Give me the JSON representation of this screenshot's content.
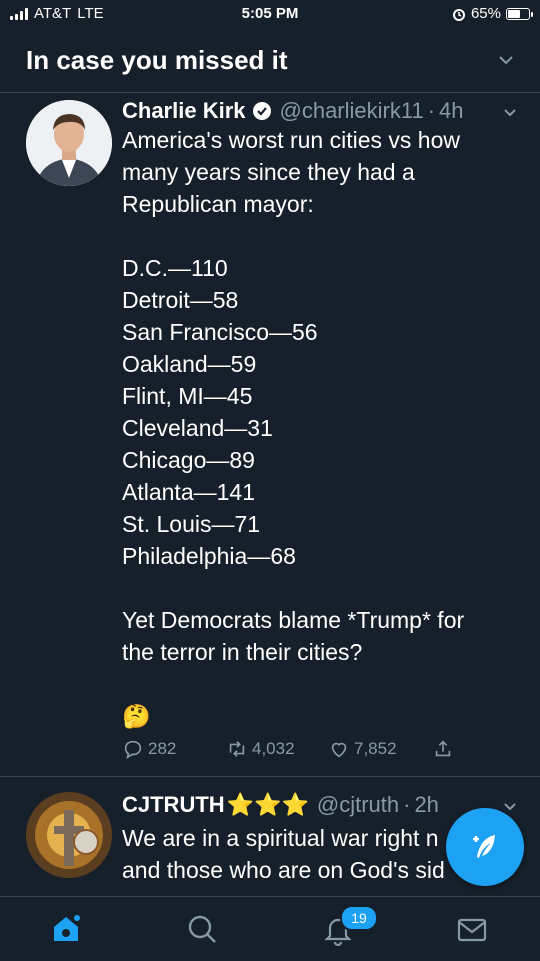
{
  "status": {
    "carrier": "AT&T",
    "network": "LTE",
    "time": "5:05 PM",
    "battery": "65%",
    "battery_level": 0.65
  },
  "header": {
    "title": "In case you missed it"
  },
  "tweets": [
    {
      "name": "Charlie Kirk",
      "handle": "@charliekirk11",
      "separator": "·",
      "time": "4h",
      "lines": [
        "America's worst run cities vs how",
        "many years since they had a",
        "Republican mayor:",
        "",
        "D.C.—110",
        "Detroit—58",
        "San Francisco—56",
        "Oakland—59",
        "Flint, MI—45",
        "Cleveland—31",
        "Chicago—89",
        "Atlanta—141",
        "St. Louis—71",
        "Philadelphia—68",
        "",
        "Yet Democrats blame *Trump* for",
        "the terror in their cities?",
        "",
        "🤔"
      ],
      "replies": "282",
      "retweets": "4,032",
      "likes": "7,852"
    },
    {
      "name": "CJTRUTH",
      "stars": "⭐⭐⭐",
      "handle": "@cjtruth",
      "separator": "·",
      "time": "2h",
      "lines": [
        "We are in a spiritual war right n",
        "and those who are on God's sid"
      ]
    }
  ],
  "tabbar": {
    "notifications_count": "19"
  },
  "colors": {
    "background": "#15202b",
    "accent": "#1da1f2",
    "muted": "#8899a6",
    "divider": "#38444d"
  }
}
